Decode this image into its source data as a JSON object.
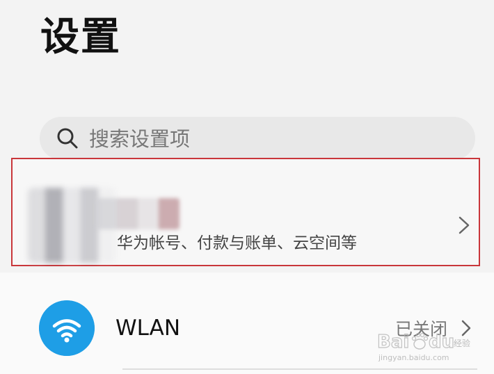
{
  "header": {
    "title": "设置"
  },
  "search": {
    "placeholder": "搜索设置项",
    "icon": "search-icon"
  },
  "account": {
    "subtitle": "华为帐号、付款与账单、云空间等",
    "highlight_color": "#c9363a"
  },
  "settings": {
    "wlan": {
      "label": "WLAN",
      "status": "已关闭",
      "icon": "wifi-icon",
      "icon_color": "#1e9ee6"
    }
  },
  "watermark": {
    "logo": "Baidu 经验",
    "url": "jingyan.baidu.com"
  }
}
